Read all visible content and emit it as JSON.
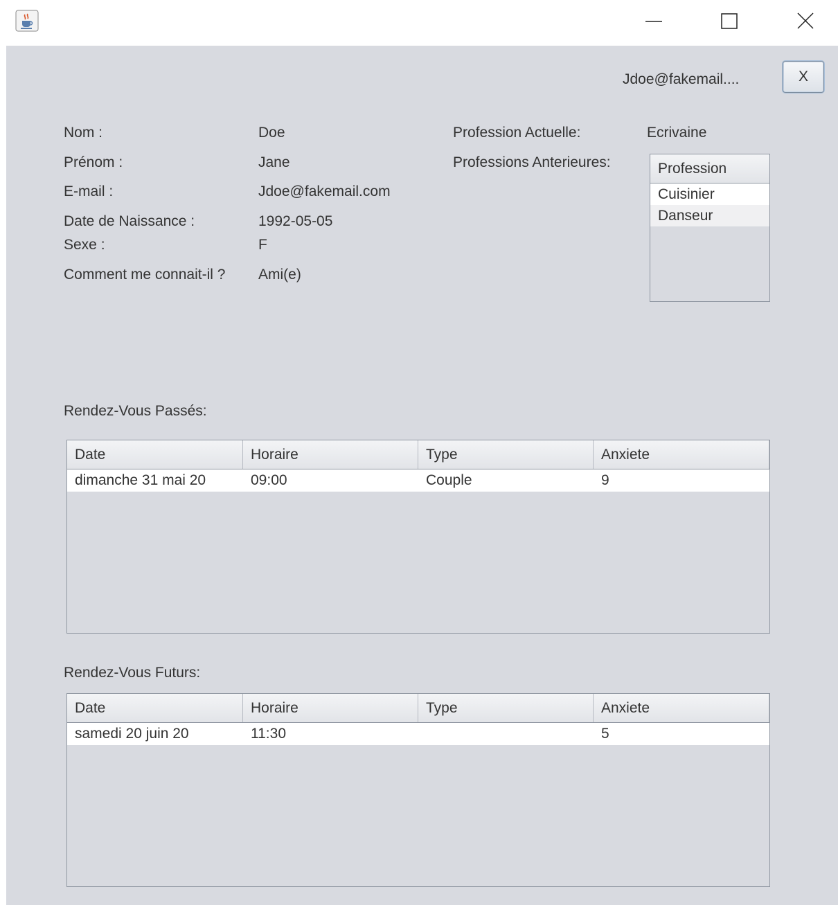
{
  "titlebar": {
    "app_icon": "java-cup-icon",
    "minimize_icon": "minimize-icon",
    "maximize_icon": "maximize-icon",
    "close_icon": "close-icon"
  },
  "header": {
    "user_email": "Jdoe@fakemail....",
    "logout_label": "X"
  },
  "profile": {
    "nom_label": "Nom :",
    "nom_value": "Doe",
    "prenom_label": "Prénom :",
    "prenom_value": "Jane",
    "email_label": "E-mail :",
    "email_value": "Jdoe@fakemail.com",
    "naissance_label": "Date de Naissance :",
    "naissance_value": "1992-05-05",
    "sexe_label": "Sexe :",
    "sexe_value": "F",
    "connait_label": "Comment me connait-il ?",
    "connait_value": "Ami(e)",
    "profession_label": "Profession Actuelle:",
    "profession_value": "Ecrivaine",
    "anterieures_label": "Professions Anterieures:"
  },
  "professions_table": {
    "header": "Profession",
    "rows": [
      "Cuisinier",
      "Danseur"
    ]
  },
  "rdv_passes": {
    "title": "Rendez-Vous Passés:",
    "columns": [
      "Date",
      "Horaire",
      "Type",
      "Anxiete"
    ],
    "rows": [
      [
        "dimanche 31 mai 20",
        "09:00",
        "Couple",
        "9"
      ]
    ]
  },
  "rdv_futurs": {
    "title": "Rendez-Vous Futurs:",
    "columns": [
      "Date",
      "Horaire",
      "Type",
      "Anxiete"
    ],
    "rows": [
      [
        "samedi 20 juin 20",
        "11:30",
        "",
        "5"
      ]
    ]
  },
  "colors": {
    "panel_background": "#d8dae0",
    "row_background": "#ffffff",
    "text": "#333333"
  }
}
